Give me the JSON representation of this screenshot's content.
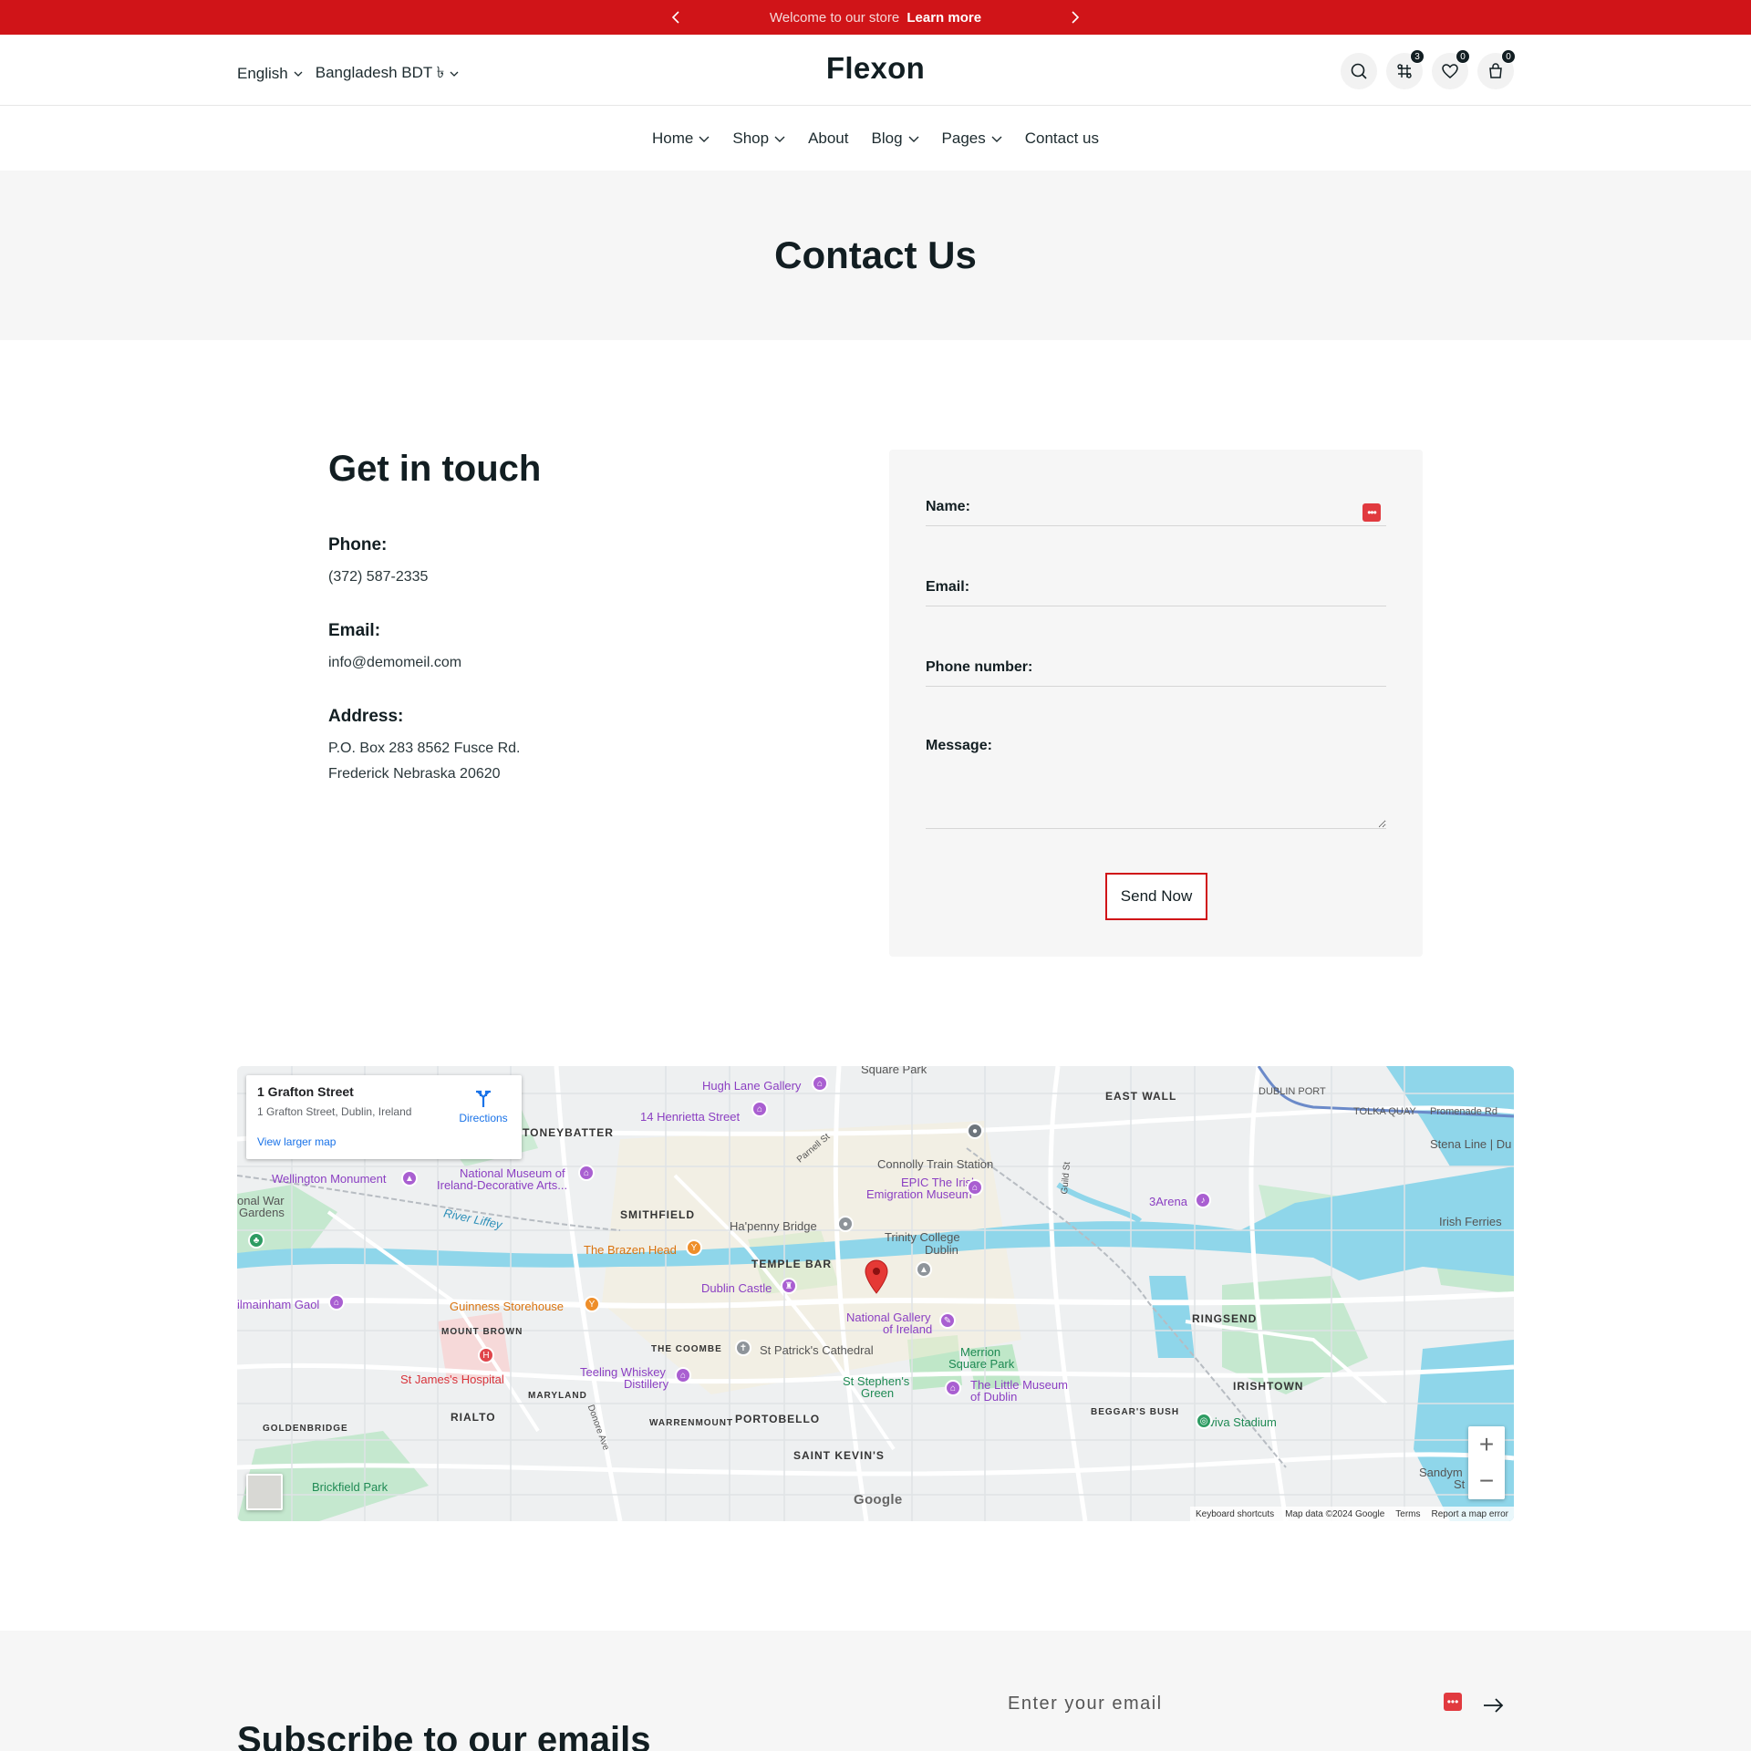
{
  "announcement": {
    "message": "Welcome to our store",
    "link": "Learn more"
  },
  "header": {
    "language": "English",
    "currency": "Bangladesh BDT ৳",
    "logo": "Flexon",
    "compare_count": "3",
    "wishlist_count": "0",
    "cart_count": "0"
  },
  "nav": {
    "items": [
      {
        "label": "Home"
      },
      {
        "label": "Shop"
      },
      {
        "label": "About"
      },
      {
        "label": "Blog"
      },
      {
        "label": "Pages"
      },
      {
        "label": "Contact us"
      }
    ]
  },
  "page": {
    "title": "Contact Us"
  },
  "contact": {
    "heading": "Get in touch",
    "phone_label": "Phone:",
    "phone": "(372) 587-2335",
    "email_label": "Email:",
    "email": "info@demomeil.com",
    "address_label": "Address:",
    "address_line1": "P.O. Box 283 8562 Fusce Rd.",
    "address_line2": "Frederick Nebraska 20620"
  },
  "form": {
    "name_label": "Name:",
    "email_label": "Email:",
    "phone_label": "Phone number:",
    "message_label": "Message:",
    "submit": "Send Now"
  },
  "map": {
    "place_name": "1 Grafton Street",
    "place_address": "1 Grafton Street, Dublin, Ireland",
    "directions": "Directions",
    "larger_map": "View larger map",
    "google": "Google",
    "footer": {
      "shortcuts": "Keyboard shortcuts",
      "data": "Map data ©2024 Google",
      "terms": "Terms",
      "report": "Report a map error"
    },
    "labels": {
      "hugh_lane": "Hugh Lane Gallery",
      "henrietta": "14 Henrietta Street",
      "stoneybatter": "TONEYBATTER",
      "east_wall": "EAST WALL",
      "dublin_port": "DUBLIN PORT",
      "tolka": "TOLKA QUAY",
      "promenade": "Promenade Rd",
      "stena": "Stena Line | Du",
      "connolly": "Connolly Train Station",
      "epic": "EPIC The Irish",
      "epic2": "Emigration Museum",
      "three_arena": "3Arena",
      "irish_ferries": "Irish Ferries",
      "wellington": "Wellington Monument",
      "nat_museum": "National Museum of",
      "nat_museum2": "Ireland-Decorative Arts...",
      "war_gardens": "onal War",
      "war_gardens2": "Gardens",
      "smithfield": "SMITHFIELD",
      "river_liffey": "River Liffey",
      "hapenny": "Ha'penny Bridge",
      "trinity": "Trinity College",
      "trinity2": "Dublin",
      "brazen": "The Brazen Head",
      "temple_bar": "TEMPLE BAR",
      "dublin_castle": "Dublin Castle",
      "kilmainham": "ilmainham Gaol",
      "guinness": "Guinness Storehouse",
      "mount_brown": "MOUNT BROWN",
      "nat_gallery": "National Gallery",
      "nat_gallery2": "of Ireland",
      "ringsend": "RINGSEND",
      "coombe": "THE COOMBE",
      "st_patricks": "St Patrick's Cathedral",
      "merrion": "Merrion",
      "merrion2": "Square Park",
      "st_james": "St James's Hospital",
      "teeling": "Teeling Whiskey",
      "teeling2": "Distillery",
      "st_stephens": "St Stephen's",
      "st_stephens2": "Green",
      "little_museum": "The Little Museum",
      "little_museum2": "of Dublin",
      "irishtown": "IRISHTOWN",
      "maryland": "MARYLAND",
      "rialto": "RIALTO",
      "warrenmount": "WARRENMOUNT",
      "portobello": "PORTOBELLO",
      "beggars_bush": "BEGGAR'S BUSH",
      "aviva": "Aviva Stadium",
      "goldenbridge": "GOLDENBRIDGE",
      "saint_kevins": "SAINT KEVIN'S",
      "brickfield": "Brickfield Park",
      "sandymount": "Sandym",
      "sandymount2": "St",
      "square_park": "Square Park",
      "guild_st": "Guild St",
      "parnell_st": "Parnell St",
      "donore_ave": "Donore Ave"
    }
  },
  "newsletter": {
    "heading": "Subscribe to our emails",
    "placeholder": "Enter your email"
  },
  "colors": {
    "brand_red": "#d01418",
    "text_dark": "#121e22",
    "section_bg": "#f6f6f6",
    "water": "#8fd6ea",
    "park": "#bfe7c8"
  }
}
